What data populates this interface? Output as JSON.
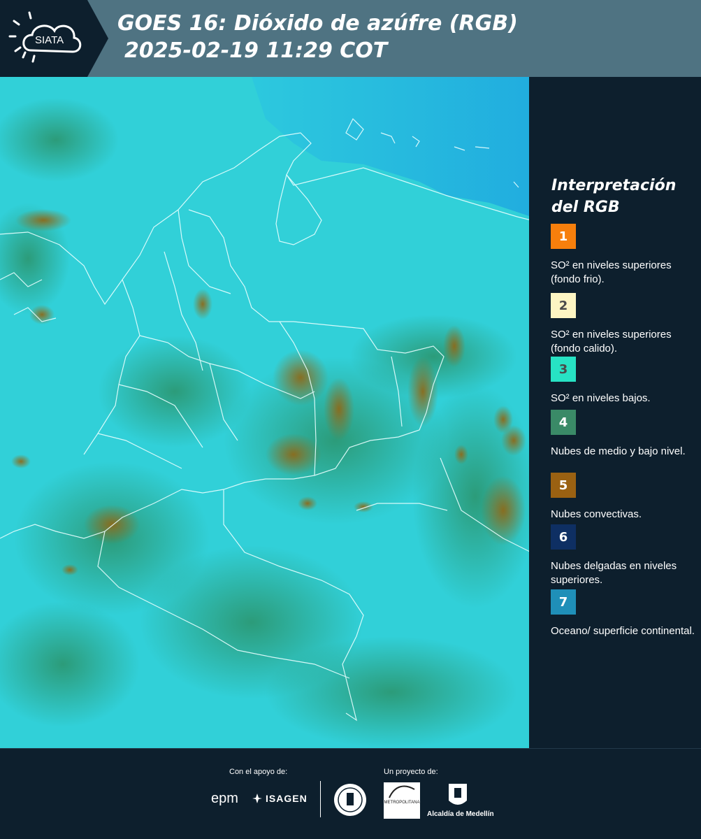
{
  "header": {
    "logo_text": "SIATA",
    "title_line1": "GOES 16: Dióxido de azúfre (RGB)",
    "title_line2": "2025-02-19 11:29 COT",
    "background_color": "#4f7382",
    "logo_background_color": "#0d1f2d"
  },
  "map": {
    "product": "GOES 16 Sulfur Dioxide RGB",
    "base_color": "#2fd2df",
    "ocean_color": "#22b0e0",
    "boundary_color": "#ffffff"
  },
  "legend": {
    "title_line1": "Interpretación",
    "title_line2": "del RGB",
    "items": [
      {
        "number": "1",
        "label": "SO² en niveles superiores (fondo frio).",
        "color": "#f77f0c",
        "text_color": "#ffffff"
      },
      {
        "number": "2",
        "label": "SO² en niveles superiores (fondo calido).",
        "color": "#fdf5c3",
        "text_color": "#4a4a4a"
      },
      {
        "number": "3",
        "label": "SO² en niveles bajos.",
        "color": "#27e2c4",
        "text_color": "#4a4a4a"
      },
      {
        "number": "4",
        "label": "Nubes de medio y bajo nivel.",
        "color": "#3a8a67",
        "text_color": "#ffffff"
      },
      {
        "number": "5",
        "label": "Nubes convectivas.",
        "color": "#9a6112",
        "text_color": "#ffffff"
      },
      {
        "number": "6",
        "label": "Nubes delgadas en niveles superiores.",
        "color": "#0e2f63",
        "text_color": "#ffffff"
      },
      {
        "number": "7",
        "label": "Oceano/ superficie continental.",
        "color": "#1f8fb8",
        "text_color": "#ffffff"
      }
    ]
  },
  "footer": {
    "support_label": "Con el apoyo de:",
    "project_label": "Un proyecto de:",
    "epm_text": "epm",
    "isagen_text": "ISAGEN",
    "amva_text": "METROPOLITANA",
    "alcaldia_text": "Alcaldía de Medellín"
  }
}
